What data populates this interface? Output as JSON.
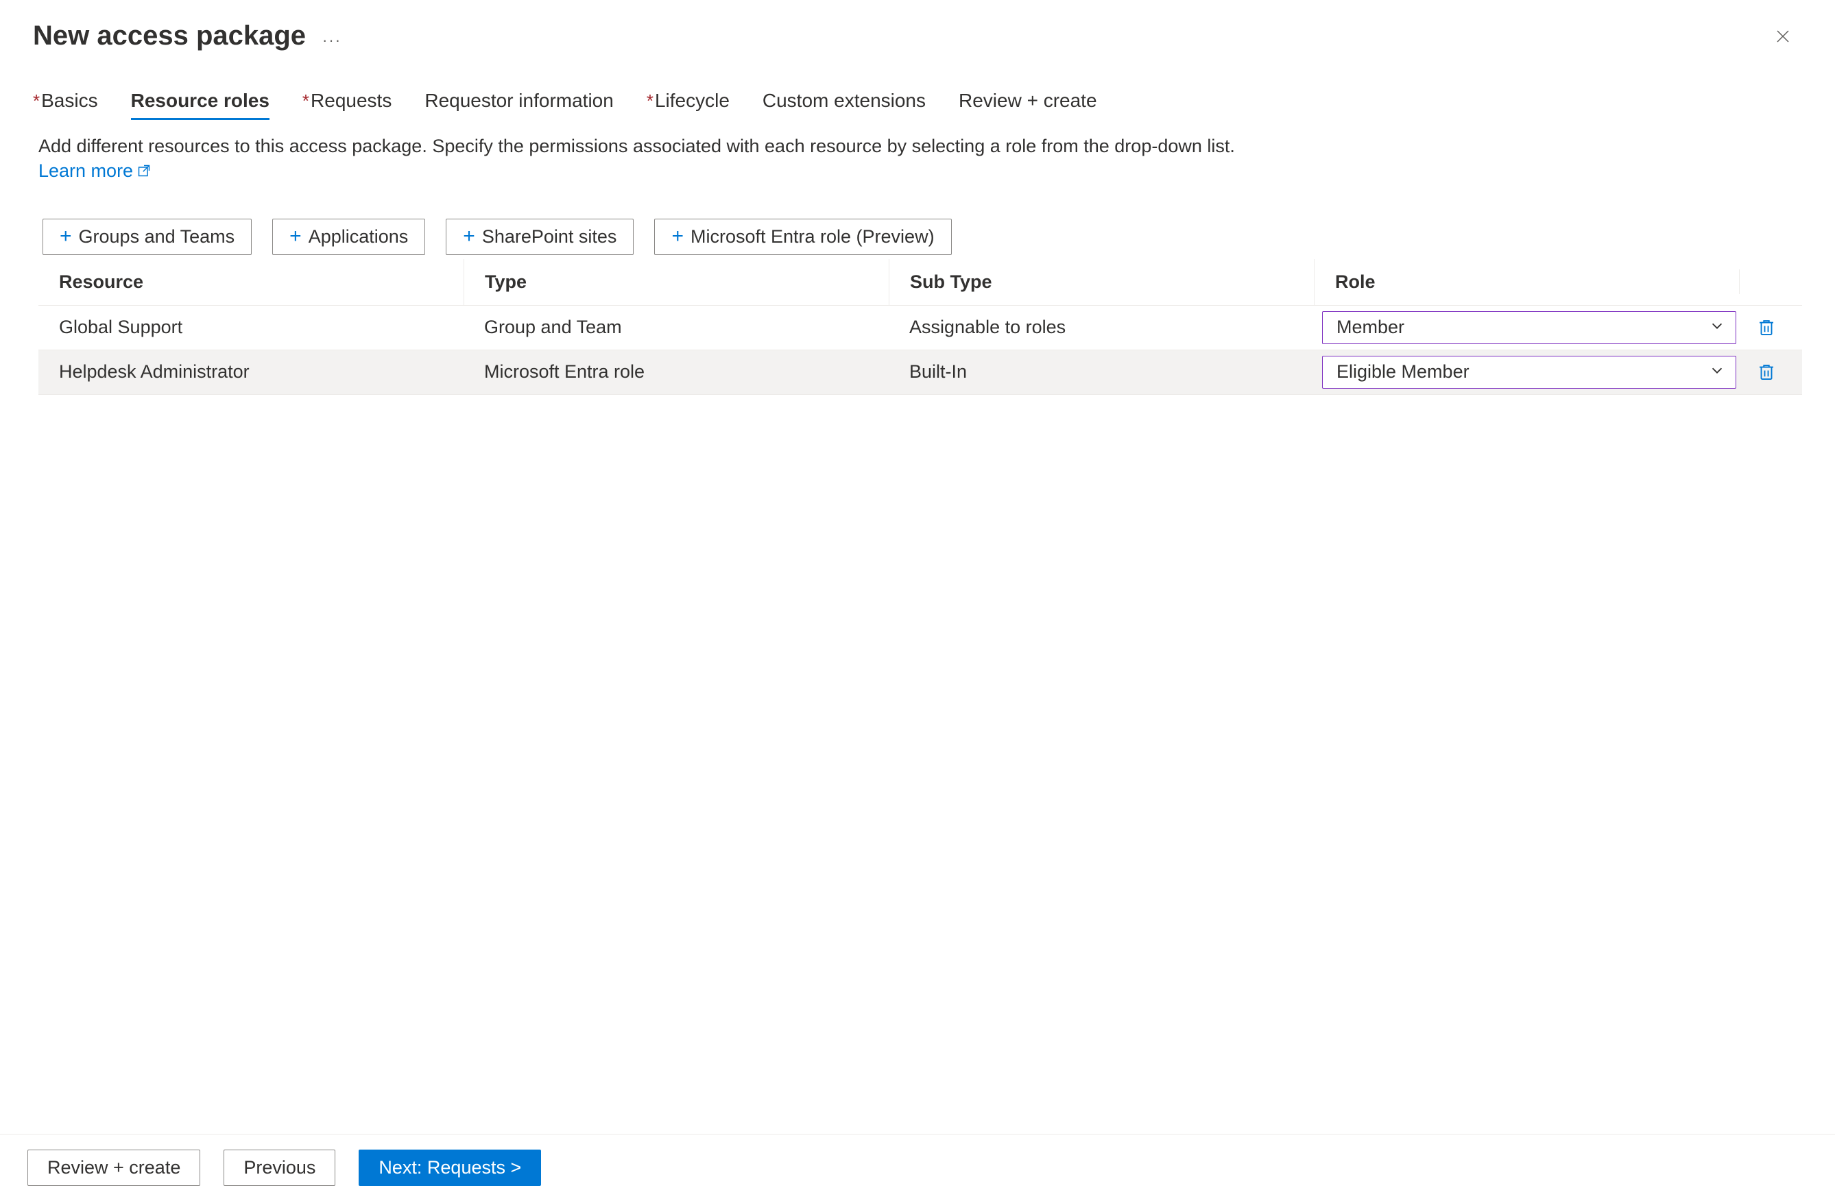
{
  "header": {
    "title": "New access package",
    "ellipsis": "···"
  },
  "tabs": [
    {
      "label": "Basics",
      "required": true,
      "active": false
    },
    {
      "label": "Resource roles",
      "required": false,
      "active": true
    },
    {
      "label": "Requests",
      "required": true,
      "active": false
    },
    {
      "label": "Requestor information",
      "required": false,
      "active": false
    },
    {
      "label": "Lifecycle",
      "required": true,
      "active": false
    },
    {
      "label": "Custom extensions",
      "required": false,
      "active": false
    },
    {
      "label": "Review + create",
      "required": false,
      "active": false
    }
  ],
  "description": {
    "text": "Add different resources to this access package. Specify the permissions associated with each resource by selecting a role from the drop-down list. ",
    "link_label": "Learn more"
  },
  "add_buttons": [
    {
      "label": "Groups and Teams"
    },
    {
      "label": "Applications"
    },
    {
      "label": "SharePoint sites"
    },
    {
      "label": "Microsoft Entra role (Preview)"
    }
  ],
  "table": {
    "headers": {
      "resource": "Resource",
      "type": "Type",
      "subtype": "Sub Type",
      "role": "Role"
    },
    "rows": [
      {
        "resource": "Global Support",
        "type": "Group and Team",
        "subtype": "Assignable to roles",
        "role": "Member"
      },
      {
        "resource": "Helpdesk Administrator",
        "type": "Microsoft Entra role",
        "subtype": "Built-In",
        "role": "Eligible Member"
      }
    ]
  },
  "footer": {
    "review": "Review + create",
    "previous": "Previous",
    "next": "Next: Requests >"
  }
}
